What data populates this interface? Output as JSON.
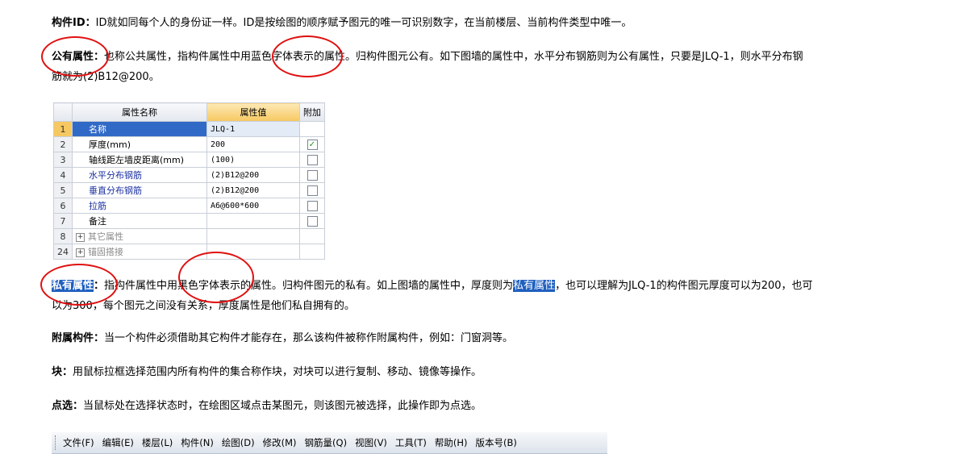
{
  "paragraphs": {
    "p1": {
      "term": "构件ID",
      "colon": "：",
      "text": "ID就如同每个人的身份证一样。ID是按绘图的顺序赋予图元的唯一可识别数字，在当前楼层、当前构件类型中唯一。"
    },
    "p2": {
      "term": "公有属性",
      "colon": "：",
      "text_line1": "也称公共属性，指构件属性中用蓝色字体表示的属性。归构件图元公有。如下图墙的属性中，水平分布钢筋则为公有属性，只要是JLQ-1，则水平分布钢",
      "text_line2": "筋就为(2)B12@200。"
    },
    "p3": {
      "term": "私有属性",
      "colon": "：",
      "text_a": "指构件属性中用黑色字体表示的属性。归构件图元的私有。如上图墙的属性中，厚度则为",
      "highlight": "私有属性",
      "text_b": "，也可以理解为JLQ-1的构件图元厚度可以为200，也可",
      "text_line2": "以为300，每个图元之间没有关系，厚度属性是他们私自拥有的。"
    },
    "p4": {
      "term": "附属构件",
      "colon": "：",
      "text": "当一个构件必须借助其它构件才能存在，那么该构件被称作附属构件，例如：门窗洞等。"
    },
    "p5": {
      "term": "块",
      "colon": "：",
      "text": "用鼠标拉框选择范围内所有构件的集合称作块，对块可以进行复制、移动、镜像等操作。"
    },
    "p6": {
      "term": "点选",
      "colon": "：",
      "text": "当鼠标处在选择状态时，在绘图区域点击某图元，则该图元被选择，此操作即为点选。"
    }
  },
  "grid": {
    "headers": {
      "name": "属性名称",
      "value": "属性值",
      "extra": "附加"
    },
    "rows": [
      {
        "num": "1",
        "name": "名称",
        "value": "JLQ-1",
        "check": "none",
        "blue": false
      },
      {
        "num": "2",
        "name": "厚度(mm)",
        "value": "200",
        "check": "checked",
        "blue": false
      },
      {
        "num": "3",
        "name": "轴线距左墙皮距离(mm)",
        "value": "(100)",
        "check": "empty",
        "blue": false
      },
      {
        "num": "4",
        "name": "水平分布钢筋",
        "value": "(2)B12@200",
        "check": "empty",
        "blue": true
      },
      {
        "num": "5",
        "name": "垂直分布钢筋",
        "value": "(2)B12@200",
        "check": "empty",
        "blue": true
      },
      {
        "num": "6",
        "name": "拉筋",
        "value": "A6@600*600",
        "check": "empty",
        "blue": true
      },
      {
        "num": "7",
        "name": "备注",
        "value": "",
        "check": "empty",
        "blue": false
      },
      {
        "num": "8",
        "name": "其它属性",
        "value": "",
        "check": "none",
        "blue": false,
        "group": true
      },
      {
        "num": "24",
        "name": "锚固搭接",
        "value": "",
        "check": "none",
        "blue": false,
        "group": true
      }
    ],
    "expand_glyph": "+",
    "check_glyph": "✓"
  },
  "menubar": {
    "items": [
      "文件(F)",
      "编辑(E)",
      "楼层(L)",
      "构件(N)",
      "绘图(D)",
      "修改(M)",
      "钢筋量(Q)",
      "视图(V)",
      "工具(T)",
      "帮助(H)",
      "版本号(B)"
    ]
  },
  "colors": {
    "annotation_circle": "#e01010",
    "highlight": "#1f5fbf",
    "blue_text": "#1a2fa0"
  }
}
